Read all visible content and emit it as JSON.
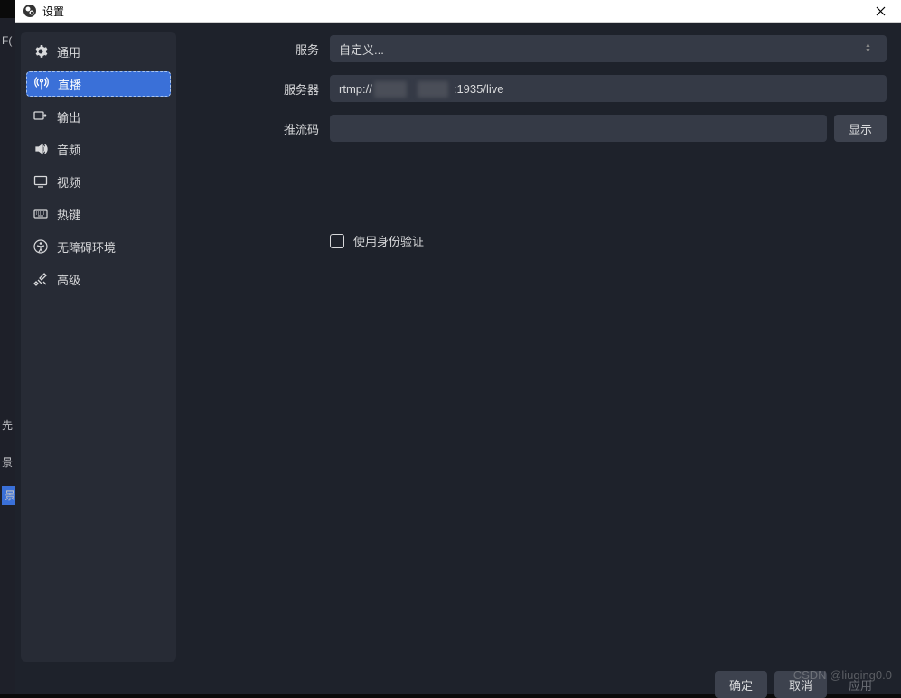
{
  "window": {
    "title": "设置",
    "close_icon": "close-icon"
  },
  "sidebar": {
    "items": [
      {
        "label": "通用",
        "icon": "gear-icon"
      },
      {
        "label": "直播",
        "icon": "antenna-icon",
        "selected": true
      },
      {
        "label": "输出",
        "icon": "output-icon"
      },
      {
        "label": "音频",
        "icon": "audio-icon"
      },
      {
        "label": "视频",
        "icon": "monitor-icon"
      },
      {
        "label": "热键",
        "icon": "keyboard-icon"
      },
      {
        "label": "无障碍环境",
        "icon": "accessibility-icon"
      },
      {
        "label": "高级",
        "icon": "tools-icon"
      }
    ]
  },
  "form": {
    "service_label": "服务",
    "service_value": "自定义...",
    "server_label": "服务器",
    "server_value_prefix": "rtmp://",
    "server_value_suffix": ":1935/live",
    "streamkey_label": "推流码",
    "streamkey_value": "",
    "show_button": "显示",
    "auth_checkbox_label": "使用身份验证",
    "auth_checked": false
  },
  "footer": {
    "ok": "确定",
    "cancel": "取消",
    "apply": "应用"
  },
  "backdrop": {
    "b1": "F(",
    "b2": "先",
    "b3": "景",
    "b4": "景"
  },
  "watermark": "CSDN @liuqing0.0"
}
